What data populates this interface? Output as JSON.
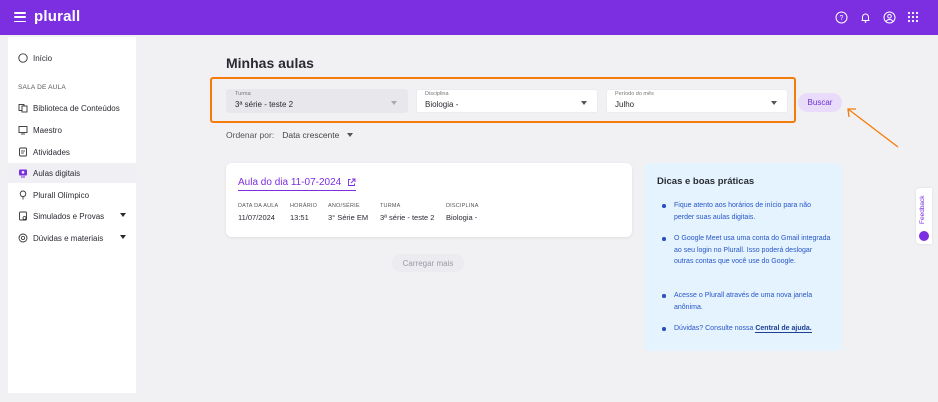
{
  "header": {
    "logo": "plurall",
    "icons": [
      "help-icon",
      "bell-icon",
      "user-icon",
      "apps-grid-icon"
    ]
  },
  "sidebar": {
    "home": "Início",
    "section": "SALA DE AULA",
    "items": [
      {
        "label": "Biblioteca de Conteúdos",
        "icon": "library-icon"
      },
      {
        "label": "Maestro",
        "icon": "maestro-icon"
      },
      {
        "label": "Atividades",
        "icon": "activities-icon"
      },
      {
        "label": "Aulas digitais",
        "icon": "digital-classes-icon",
        "active": true
      },
      {
        "label": "Plurall Olímpico",
        "icon": "olympic-icon"
      },
      {
        "label": "Simulados e Provas",
        "icon": "tests-icon",
        "expandable": true
      },
      {
        "label": "Dúvidas e materiais",
        "icon": "questions-icon",
        "expandable": true
      }
    ]
  },
  "main": {
    "title": "Minhas aulas",
    "filters": {
      "turma": {
        "label": "Turma",
        "value": "3ª série - teste 2"
      },
      "disciplina": {
        "label": "Disciplina",
        "value": "Biologia -"
      },
      "periodo": {
        "label": "Período do mês",
        "value": "Julho"
      }
    },
    "search_button": "Buscar",
    "sort": {
      "label": "Ordenar por:",
      "value": "Data crescente"
    },
    "lesson": {
      "title": "Aula do dia 11-07-2024",
      "columns": [
        {
          "header": "DATA DA AULA",
          "value": "11/07/2024"
        },
        {
          "header": "HORÁRIO",
          "value": "13:51"
        },
        {
          "header": "ANO/SÉRIE",
          "value": "3° Série EM"
        },
        {
          "header": "TURMA",
          "value": "3ª série - teste 2"
        },
        {
          "header": "DISCIPLINA",
          "value": "Biologia -"
        }
      ]
    },
    "load_more": "Carregar mais"
  },
  "tips": {
    "title": "Dicas e boas práticas",
    "items": [
      "Fique atento aos horários de início para não perder suas aulas digitais.",
      "O Google Meet usa uma conta do Gmail integrada ao seu login no Plurall. Isso poderá deslogar outras contas que você use do Google.",
      "Acesse o Plurall através de uma nova janela anônima.",
      "Dúvidas? Consulte nossa"
    ],
    "help_link": "Central de ajuda."
  },
  "feedback": "Feedback",
  "colors": {
    "brand": "#7b2fe0",
    "highlight": "#f57c0a",
    "tips_bg": "#e4f3fd"
  }
}
